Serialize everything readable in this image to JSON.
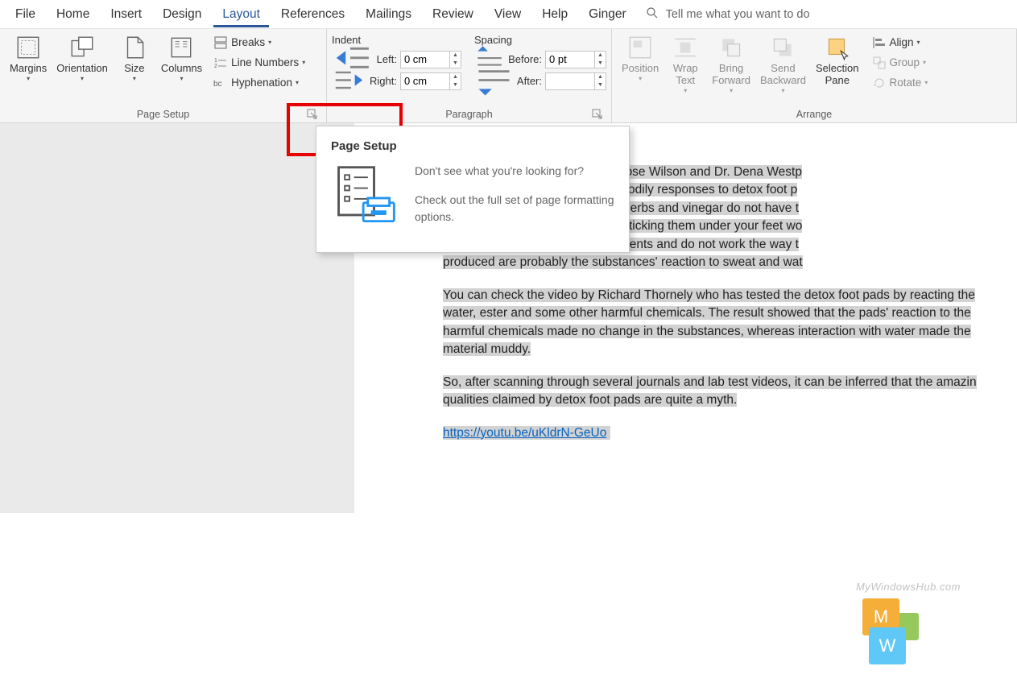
{
  "menubar": {
    "items": [
      "File",
      "Home",
      "Insert",
      "Design",
      "Layout",
      "References",
      "Mailings",
      "Review",
      "View",
      "Help",
      "Ginger"
    ],
    "active_index": 4,
    "tellme_placeholder": "Tell me what you want to do"
  },
  "ribbon": {
    "page_setup": {
      "label": "Page Setup",
      "margins": "Margins",
      "orientation": "Orientation",
      "size": "Size",
      "columns": "Columns",
      "breaks": "Breaks",
      "line_numbers": "Line Numbers",
      "hyphenation": "Hyphenation"
    },
    "paragraph": {
      "label": "Paragraph",
      "indent_header": "Indent",
      "spacing_header": "Spacing",
      "left_label": "Left:",
      "right_label": "Right:",
      "before_label": "Before:",
      "after_label": "After:",
      "left_value": "0 cm",
      "right_value": "0 cm",
      "before_value": "0 pt",
      "after_value": ""
    },
    "arrange": {
      "label": "Arrange",
      "position": "Position",
      "wrap_text": "Wrap\nText",
      "bring_forward": "Bring\nForward",
      "send_backward": "Send\nBackward",
      "selection_pane": "Selection\nPane",
      "align": "Align",
      "group": "Group",
      "rotate": "Rotate"
    }
  },
  "tooltip": {
    "title": "Page Setup",
    "line1": "Don't see what you're looking for?",
    "line2": "Check out the full set of page formatting options."
  },
  "document": {
    "p1": "y Healthline, doctors Dr. Debra Rose Wilson and Dr. Dena Westp",
    "p1b": "According to them, there are no bodily responses to detox foot p",
    "p1c": ". Simple pads containing certain herbs and vinegar do not have t",
    "p1d": "he body overnight. Even though sticking them under your feet wo",
    "p1e": "e products make false advertisements and do not work the way t",
    "p1f": "produced are probably the substances' reaction to sweat and wat",
    "p2": "You can check the video by Richard Thornely who has tested the detox foot pads by reacting the",
    "p2b": "water, ester and some other harmful chemicals. The result showed that the pads' reaction to the",
    "p2c": "harmful chemicals made no change in the substances, whereas interaction with water made the",
    "p2d": "material muddy.",
    "p3": "So, after scanning through several journals and lab test videos, it can be inferred that the amazin",
    "p3b": "qualities claimed by detox foot pads are quite a myth.",
    "link": "https://youtu.be/uKldrN-GeUo"
  },
  "watermark": {
    "text": "MyWindowsHub.com"
  }
}
